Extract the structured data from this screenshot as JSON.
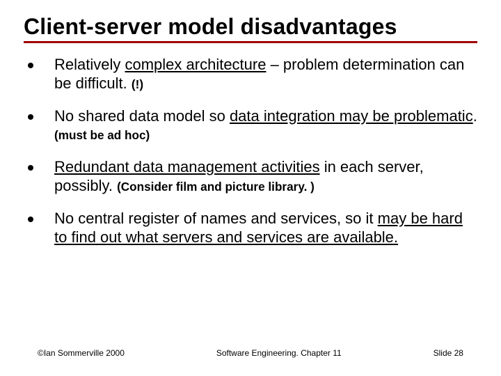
{
  "title": "Client-server model disadvantages",
  "bullets": [
    {
      "pre": "Relatively ",
      "underlined": "complex architecture",
      "post": " – problem determination can be difficult. ",
      "annotation": "(!)",
      "tail_pre": "",
      "tail_underlined": "",
      "tail_post": ""
    },
    {
      "pre": "No shared data model so ",
      "underlined": "data integration may be problematic",
      "post": ". ",
      "annotation": "(must  be ad hoc)",
      "tail_pre": "",
      "tail_underlined": "",
      "tail_post": ""
    },
    {
      "pre": "",
      "underlined": "Redundant data management activities",
      "post": " in each server, possibly. ",
      "annotation": "(Consider film and picture library. )",
      "tail_pre": "",
      "tail_underlined": "",
      "tail_post": ""
    },
    {
      "pre": "No central register of names and services, so it ",
      "underlined": "may be hard to find out what servers and services are available",
      "post": "",
      "annotation": "",
      "tail_pre": "",
      "tail_underlined": ".",
      "tail_post": ""
    }
  ],
  "footer": {
    "left": "©Ian Sommerville 2000",
    "center": "Software Engineering. Chapter 11",
    "right": "Slide 28"
  }
}
